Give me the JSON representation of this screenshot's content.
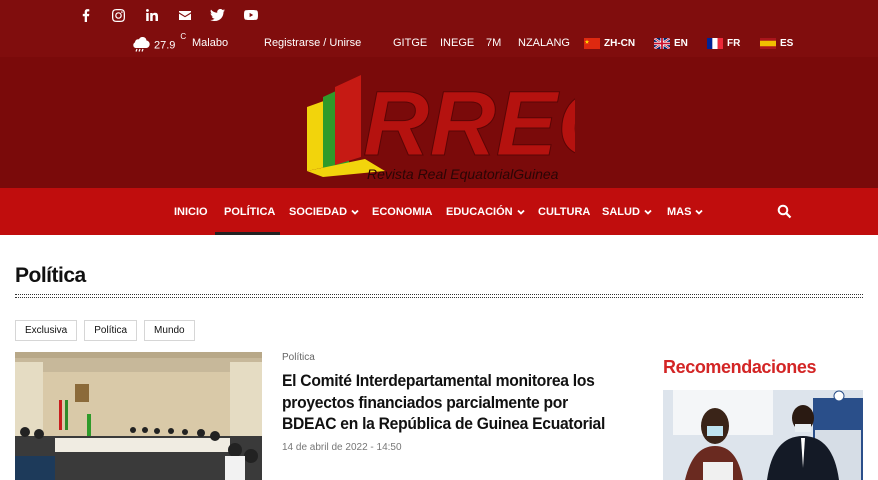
{
  "social": {
    "icons": [
      "facebook-icon",
      "instagram-icon",
      "linkedin-icon",
      "mail-icon",
      "twitter-icon",
      "youtube-icon"
    ]
  },
  "util": {
    "weather_icon": "rain-cloud-icon",
    "temperature": "27.9",
    "temp_unit": "C",
    "city": "Malabo",
    "register": "Registrarse / Unirse",
    "links": [
      "GITGE",
      "INEGE",
      "7M",
      "NZALANG"
    ],
    "languages": [
      {
        "code": "ZH-CN",
        "flag": "china"
      },
      {
        "code": "EN",
        "flag": "uk"
      },
      {
        "code": "FR",
        "flag": "france"
      },
      {
        "code": "ES",
        "flag": "spain"
      }
    ]
  },
  "logo": {
    "text": "RREG",
    "tagline": "Revista Real EquatorialGuinea"
  },
  "nav": {
    "items": [
      "INICIO",
      "POLÍTICA",
      "SOCIEDAD",
      "ECONOMIA",
      "EDUCACIÓN",
      "CULTURA",
      "SALUD",
      "MAS"
    ],
    "active": "POLÍTICA"
  },
  "page": {
    "title": "Política",
    "tags": [
      "Exclusiva",
      "Política",
      "Mundo"
    ]
  },
  "article": {
    "category": "Política",
    "title": "El Comité Interdepartamental monitorea los proyectos financiados parcialmente por BDEAC en la República de Guinea Ecuatorial",
    "date": "14 de abril de 2022 - 14:50"
  },
  "sidebar": {
    "title": "Recomendaciones"
  },
  "colors": {
    "topbar": "#800d0d",
    "header": "#7a0a0a",
    "nav": "#c00d0d",
    "accent_red": "#d32525"
  }
}
